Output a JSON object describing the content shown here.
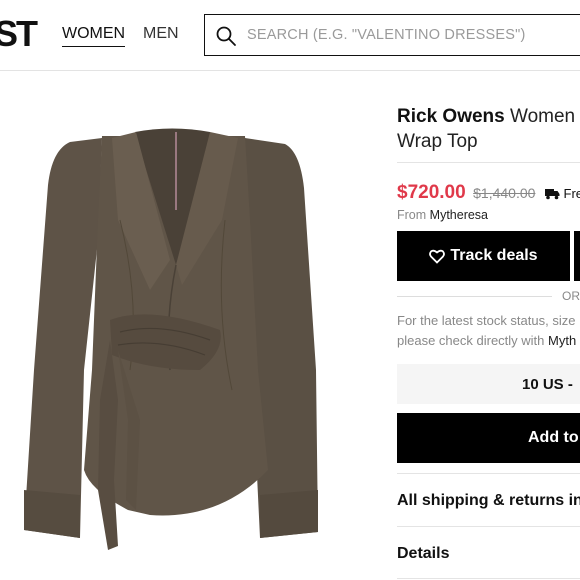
{
  "header": {
    "logo": "ST",
    "nav": [
      "WOMEN",
      "MEN"
    ],
    "search_placeholder": "SEARCH (E.G. \"VALENTINO DRESSES\")"
  },
  "product": {
    "brand": "Rick Owens",
    "name_rest": "Women",
    "name_line2": "Wrap Top",
    "price": "$720.00",
    "old_price": "$1,440.00",
    "shipping": "Fre",
    "from_label": "From",
    "store": "Mytheresa",
    "track_label": "Track deals",
    "or_label": "OR",
    "note_line1": "For the latest stock status, size",
    "note_line2_prefix": "please check directly with",
    "note_line2_store": "Myth",
    "size": "10 US -",
    "add_label": "Add to",
    "shipping_returns": "All shipping & returns in",
    "details": "Details"
  },
  "colors": {
    "price": "#e0394a",
    "garment": "#5e5347",
    "button": "#000000"
  }
}
